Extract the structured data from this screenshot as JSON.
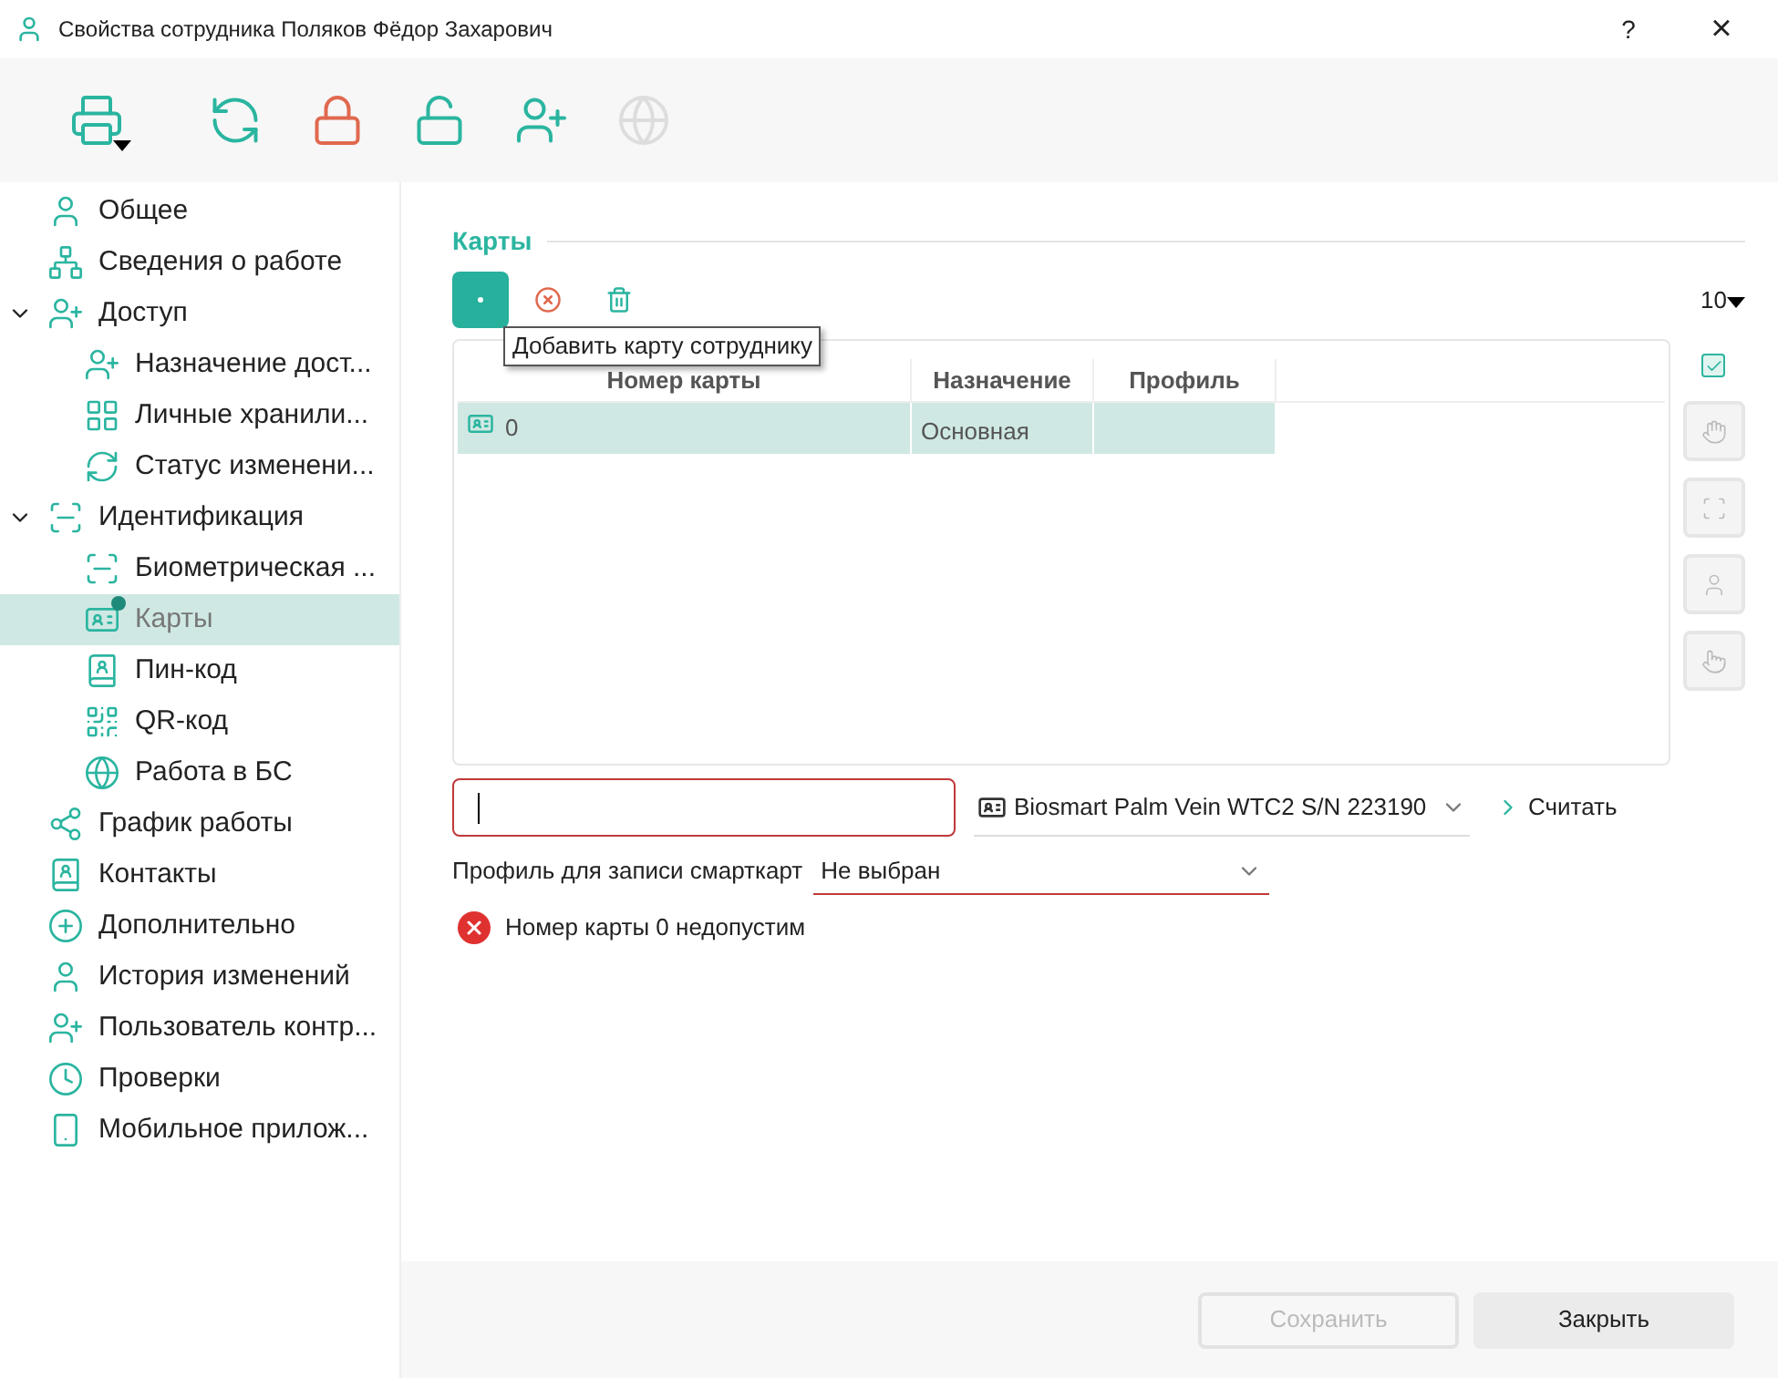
{
  "window": {
    "title": "Свойства сотрудника Поляков Фёдор Захарович",
    "help": "?",
    "close": "×"
  },
  "toolbar": [
    {
      "disabled": false
    },
    {
      "disabled": false
    },
    {
      "disabled": false
    },
    {
      "disabled": false
    },
    {
      "disabled": false
    },
    {
      "disabled": true
    }
  ],
  "sidebar": {
    "items": [
      {
        "label": "Общее",
        "selected": false
      },
      {
        "label": "Сведения о работе",
        "selected": false
      },
      {
        "label": "Доступ",
        "selected": false,
        "expanded": true,
        "children": [
          {
            "label": "Назначение дост...",
            "selected": false
          },
          {
            "label": "Личные хранили...",
            "selected": false
          },
          {
            "label": "Статус изменени...",
            "selected": false
          }
        ]
      },
      {
        "label": "Идентификация",
        "selected": false,
        "expanded": true,
        "children": [
          {
            "label": "Биометрическая ...",
            "selected": false
          },
          {
            "label": "Карты",
            "selected": true
          },
          {
            "label": "Пин-код",
            "selected": false
          },
          {
            "label": "QR-код",
            "selected": false
          },
          {
            "label": "Работа в БС",
            "selected": false
          }
        ]
      },
      {
        "label": "График работы",
        "selected": false
      },
      {
        "label": "Контакты",
        "selected": false
      },
      {
        "label": "Дополнительно",
        "selected": false
      },
      {
        "label": "История изменений",
        "selected": false
      },
      {
        "label": "Пользователь контр...",
        "selected": false
      },
      {
        "label": "Проверки",
        "selected": false
      },
      {
        "label": "Мобильное прилож...",
        "selected": false
      }
    ]
  },
  "section": {
    "title": "Карты",
    "tooltip": "Добавить карту сотруднику",
    "page_size": "10",
    "select_all": {
      "checked": true
    },
    "side_tools": [
      {
        "disabled": true
      },
      {
        "disabled": true
      },
      {
        "disabled": true
      },
      {
        "disabled": true
      }
    ],
    "table": {
      "columns": [
        "Номер карты",
        "Назначение",
        "Профиль"
      ],
      "rows": [
        {
          "cells": [
            "0",
            "Основная",
            ""
          ],
          "selected": true
        }
      ]
    },
    "card_input": {
      "invalid": true
    },
    "reader": {
      "value": "Biosmart Palm Vein WTC2 S/N 223190"
    },
    "read_button": "Считать",
    "profile": {
      "label": "Профиль для записи смарткарт",
      "value": "Не выбран"
    },
    "error": "Номер карты 0 недопустим"
  },
  "footer": {
    "buttons": [
      {
        "label": "Сохранить",
        "disabled": true
      },
      {
        "label": "Закрыть",
        "disabled": false
      }
    ]
  }
}
